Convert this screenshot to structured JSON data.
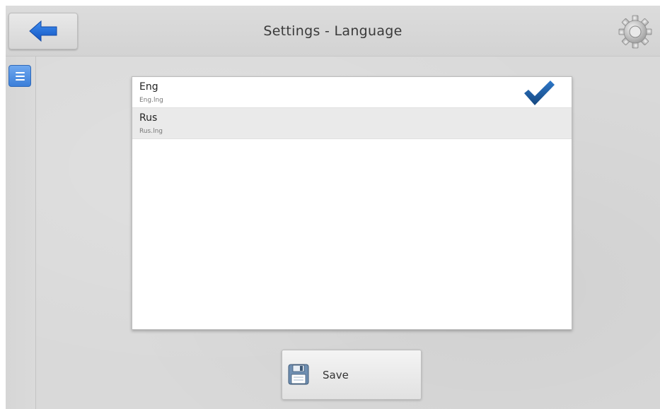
{
  "header": {
    "title": "Settings - Language",
    "back_icon": "arrow-left-icon",
    "settings_icon": "gear-icon"
  },
  "sidebar": {
    "menu_icon": "menu-icon"
  },
  "languages": {
    "items": [
      {
        "name": "Eng",
        "file": "Eng.lng",
        "selected": true
      },
      {
        "name": "Rus",
        "file": "Rus.lng",
        "selected": false
      }
    ]
  },
  "footer": {
    "save_label": "Save",
    "save_icon": "floppy-disk-icon"
  },
  "colors": {
    "accent_blue": "#1f6fd8",
    "check_blue": "#1e5aa8",
    "background": "#d9d9d9"
  }
}
